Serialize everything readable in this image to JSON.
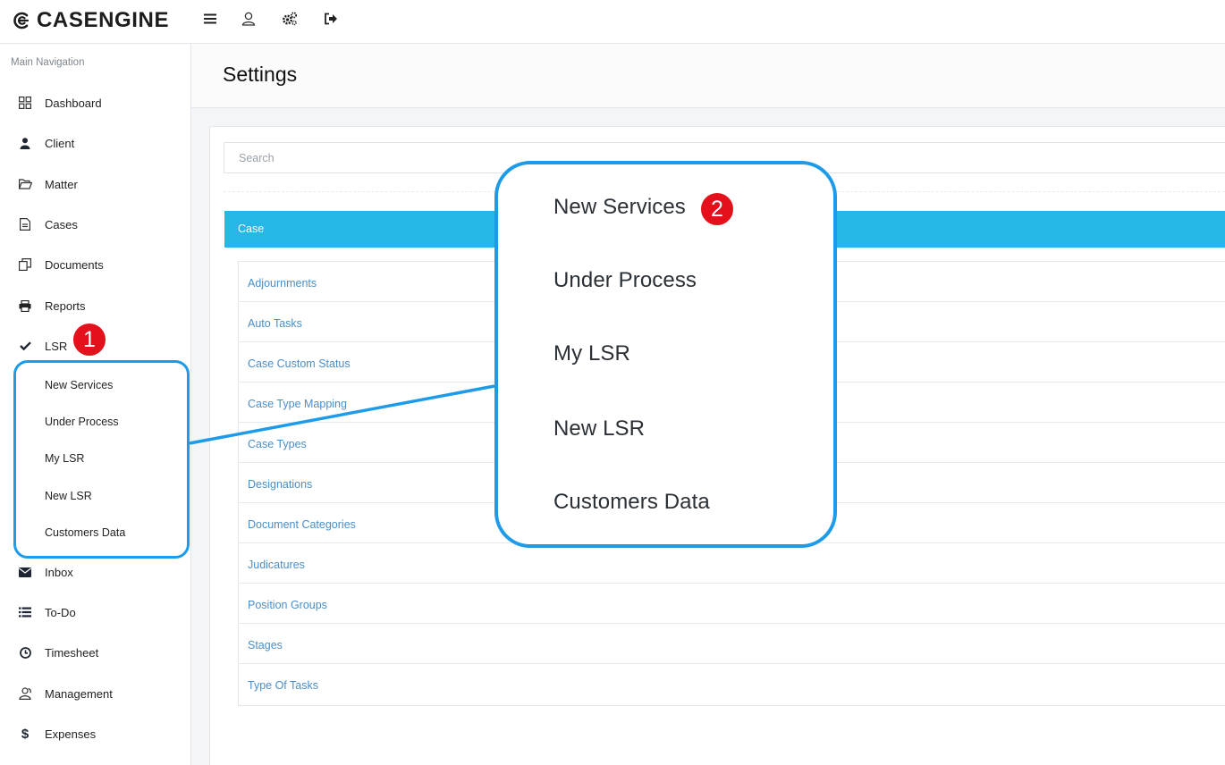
{
  "header": {
    "brand": "CASENGINE",
    "icons": [
      "menu-icon",
      "user-icon",
      "gears-icon",
      "sign-out-icon"
    ]
  },
  "sidebar": {
    "heading": "Main Navigation",
    "items": [
      {
        "label": "Dashboard",
        "icon": "grid-icon"
      },
      {
        "label": "Client",
        "icon": "user-icon"
      },
      {
        "label": "Matter",
        "icon": "folder-open-icon"
      },
      {
        "label": "Cases",
        "icon": "document-icon"
      },
      {
        "label": "Documents",
        "icon": "copy-icon"
      },
      {
        "label": "Reports",
        "icon": "printer-icon"
      },
      {
        "label": "LSR",
        "icon": "check-icon"
      },
      {
        "label": "Inbox",
        "icon": "envelope-icon"
      },
      {
        "label": "To-Do",
        "icon": "list-icon"
      },
      {
        "label": "Timesheet",
        "icon": "clock-icon"
      },
      {
        "label": "Management",
        "icon": "users-icon"
      },
      {
        "label": "Expenses",
        "icon": "dollar-icon"
      }
    ],
    "lsr_submenu": [
      "New Services",
      "Under Process",
      "My LSR",
      "New LSR",
      "Customers Data"
    ]
  },
  "main": {
    "title": "Settings",
    "search_placeholder": "Search",
    "section": "Case",
    "items": [
      "Adjournments",
      "Auto Tasks",
      "Case Custom Status",
      "Case Type Mapping",
      "Case Types",
      "Designations",
      "Document Categories",
      "Judicatures",
      "Position Groups",
      "Stages",
      "Type Of Tasks"
    ]
  },
  "annotations": {
    "badge_1": "1",
    "badge_2": "2",
    "zoom_items": [
      "New Services",
      "Under Process",
      "My LSR",
      "New LSR",
      "Customers Data"
    ],
    "color": "#1e9be8",
    "badge_color": "#e4101c"
  }
}
